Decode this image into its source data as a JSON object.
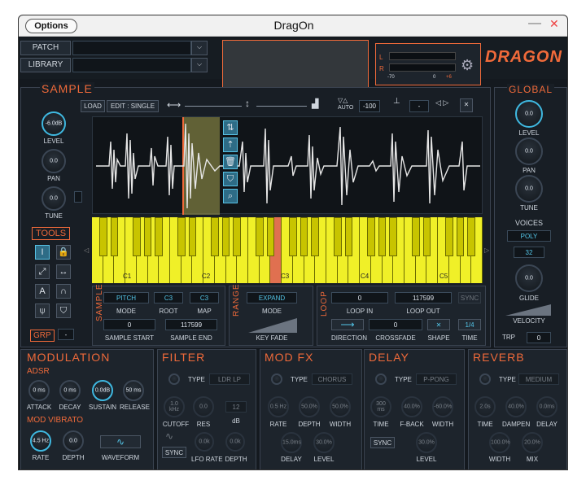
{
  "app": {
    "title": "DragOn",
    "options_label": "Options",
    "min": "—",
    "close": "✕"
  },
  "top": {
    "patch_label": "PATCH",
    "library_label": "LIBRARY",
    "meter_l": "L",
    "meter_r": "R",
    "meter_min": "-70",
    "meter_mid": "0",
    "meter_max": "+6",
    "logo": "DRAGON"
  },
  "sample": {
    "heading": "SAMPLE",
    "load": "LOAD",
    "edit": "EDIT : SINGLE",
    "auto": "AUTO",
    "gain": "-100",
    "level_val": "-6.0dB",
    "level": "LEVEL",
    "pan_val": "0.0",
    "pan": "PAN",
    "tune_val": "0.0",
    "tune": "TUNE",
    "tools": "TOOLS",
    "grp": "GRP",
    "grp_val": "-",
    "keys": [
      "C1",
      "C2",
      "C3",
      "C4",
      "C5"
    ],
    "misc_field": "-"
  },
  "params": {
    "sample_vlabel": "SAMPLE",
    "pitch": "PITCH",
    "c3a": "C3",
    "c3b": "C3",
    "mode": "MODE",
    "root": "ROOT",
    "map": "MAP",
    "start_val": "0",
    "end_val": "117599",
    "start": "SAMPLE START",
    "end": "SAMPLE END",
    "range_vlabel": "RANGE",
    "expand": "EXPAND",
    "rmode": "MODE",
    "keyfade": "KEY FADE",
    "loop_vlabel": "LOOP",
    "loop_in_val": "0",
    "loop_out_val": "117599",
    "loop_in": "LOOP IN",
    "loop_out": "LOOP OUT",
    "sync": "SYNC",
    "xfade_val": "0",
    "direction": "DIRECTION",
    "crossfade": "CROSSFADE",
    "shape": "SHAPE",
    "time_val": "1/4",
    "time": "TIME"
  },
  "global": {
    "heading": "GLOBAL",
    "level_val": "0.0",
    "level": "LEVEL",
    "pan_val": "0.0",
    "pan": "PAN",
    "tune_val": "0.0",
    "tune": "TUNE",
    "voices": "VOICES",
    "poly": "POLY",
    "count": "32",
    "glide_val": "0.0",
    "glide": "GLIDE",
    "velocity": "VELOCITY",
    "trp": "TRP",
    "trp_val": "0"
  },
  "mod": {
    "heading": "MODULATION",
    "adsr": "ADSR",
    "attack_val": "0 ms",
    "decay_val": "0 ms",
    "sustain_val": "0.0dB",
    "release_val": "50 ms",
    "attack": "ATTACK",
    "decay": "DECAY",
    "sustain": "SUSTAIN",
    "release": "RELEASE",
    "vibrato": "MOD VIBRATO",
    "rate_val": "4.5 Hz",
    "depth_val": "0.0",
    "rate": "RATE",
    "depth": "DEPTH",
    "waveform": "WAVEFORM"
  },
  "filter": {
    "heading": "FILTER",
    "type": "TYPE",
    "type_val": "LDR LP",
    "cutoff_val": "1.0 kHz",
    "res_val": "0.0",
    "db_val": "12",
    "cutoff": "CUTOFF",
    "res": "RES",
    "db": "dB",
    "sync": "SYNC",
    "lfo_val": "0.0k",
    "depth_val": "0.0k",
    "lfo": "LFO RATE",
    "depth": "DEPTH"
  },
  "modfx": {
    "heading": "MOD FX",
    "type": "TYPE",
    "type_val": "CHORUS",
    "rate_val": "0.5 Hz",
    "depth_val": "50.0%",
    "width_val": "50.0%",
    "rate": "RATE",
    "depth": "DEPTH",
    "width": "WIDTH",
    "delay_val": "15.0ms",
    "level_val": "30.0%",
    "delay": "DELAY",
    "level": "LEVEL"
  },
  "delay": {
    "heading": "DELAY",
    "type": "TYPE",
    "type_val": "P-PONG",
    "time_val": "300 ms",
    "fback_val": "40.0%",
    "width_val": "-60.0%",
    "time": "TIME",
    "fback": "F-BACK",
    "width": "WIDTH",
    "sync": "SYNC",
    "level_val": "30.0%",
    "level": "LEVEL"
  },
  "reverb": {
    "heading": "REVERB",
    "type": "TYPE",
    "type_val": "MEDIUM",
    "time_val": "2.0s",
    "dampen_val": "40.0%",
    "delay_val": "0.0ms",
    "time": "TIME",
    "dampen": "DAMPEN",
    "delay": "DELAY",
    "width_val": "100.0%",
    "mix_val": "20.0%",
    "width": "WIDTH",
    "mix": "MIX"
  },
  "colors": {
    "accent": "#f06a3a",
    "cyan": "#54c6e8",
    "keys": "#f0f028",
    "root_key": "#e07050"
  }
}
